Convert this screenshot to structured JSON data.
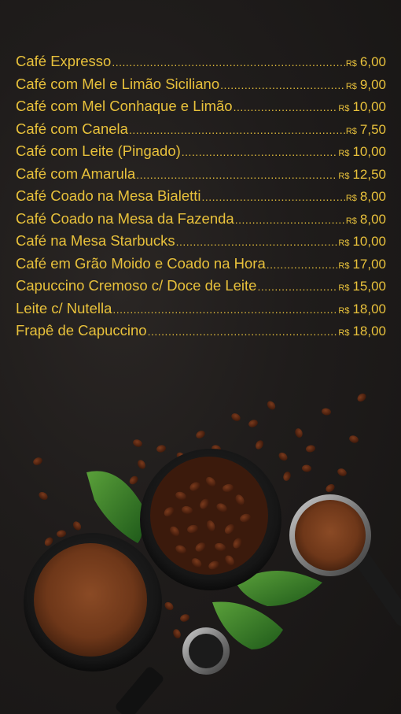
{
  "menu": {
    "items": [
      {
        "name": "Café Expresso",
        "currency": "R$",
        "price": "6,00"
      },
      {
        "name": "Café com Mel e Limão Siciliano",
        "currency": "R$",
        "price": "9,00"
      },
      {
        "name": "Café com Mel Conhaque e Limão",
        "currency": "R$",
        "price": "10,00"
      },
      {
        "name": "Café com Canela",
        "currency": "R$",
        "price": "7,50"
      },
      {
        "name": "Café com Leite (Pingado)",
        "currency": "R$",
        "price": "10,00"
      },
      {
        "name": "Café com Amarula",
        "currency": "R$",
        "price": "12,50"
      },
      {
        "name": "Café Coado na Mesa Bialetti",
        "currency": "R$",
        "price": "8,00"
      },
      {
        "name": "Café Coado na Mesa da Fazenda",
        "currency": "R$",
        "price": "8,00"
      },
      {
        "name": "Café na Mesa Starbucks",
        "currency": "R$",
        "price": "10,00"
      },
      {
        "name": "Café em Grão Moido e Coado na Hora",
        "currency": "R$",
        "price": "17,00"
      },
      {
        "name": "Capuccino Cremoso c/ Doce de Leite",
        "currency": "R$",
        "price": "15,00"
      },
      {
        "name": "Leite c/ Nutella",
        "currency": "R$",
        "price": "18,00"
      },
      {
        "name": "Frapê de Capuccino",
        "currency": "R$",
        "price": "18,00"
      }
    ]
  },
  "colors": {
    "text": "#e8c13b",
    "background": "#1e1b1a"
  }
}
